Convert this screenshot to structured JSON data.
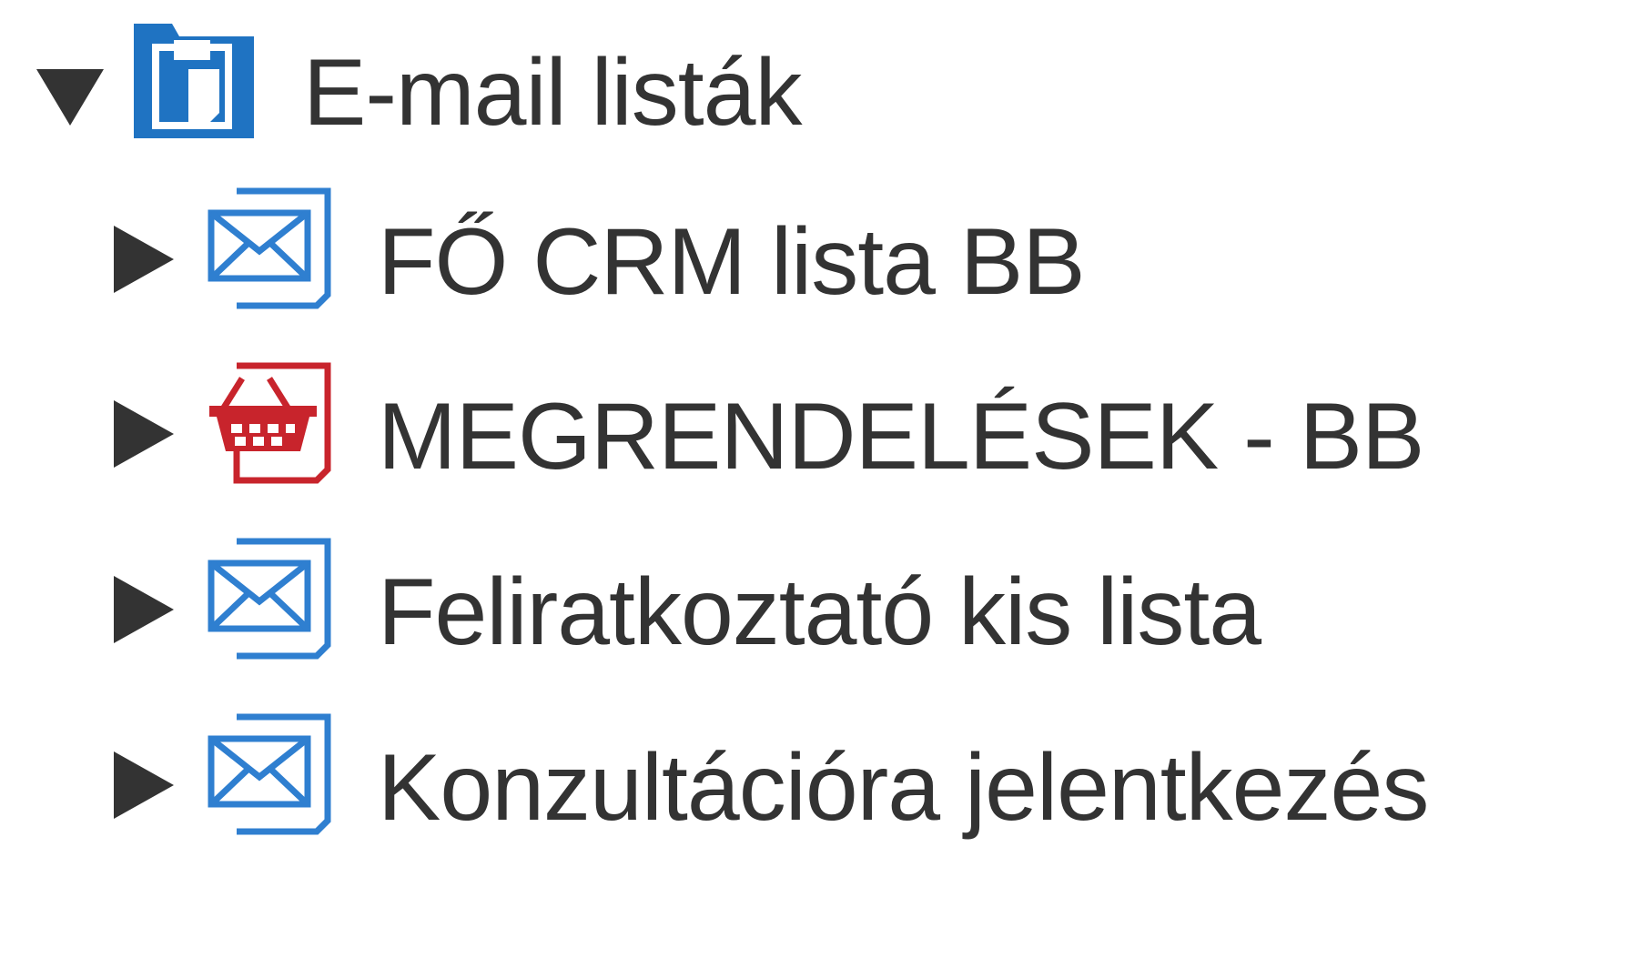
{
  "tree": {
    "root": {
      "label": "E-mail listák",
      "expanded": true,
      "icon": "folder-clipboard-icon",
      "color": "#1f73c2"
    },
    "children": [
      {
        "label": "FŐ CRM lista BB",
        "icon": "mail-list-icon",
        "color": "#2f7fd0",
        "expanded": false
      },
      {
        "label": "MEGRENDELÉSEK - BB",
        "icon": "shopping-basket-icon",
        "color": "#c8242c",
        "expanded": false
      },
      {
        "label": "Feliratkoztató kis lista",
        "icon": "mail-list-icon",
        "color": "#2f7fd0",
        "expanded": false
      },
      {
        "label": "Konzultációra jelentkezés",
        "icon": "mail-list-icon",
        "color": "#2f7fd0",
        "expanded": false
      }
    ]
  }
}
